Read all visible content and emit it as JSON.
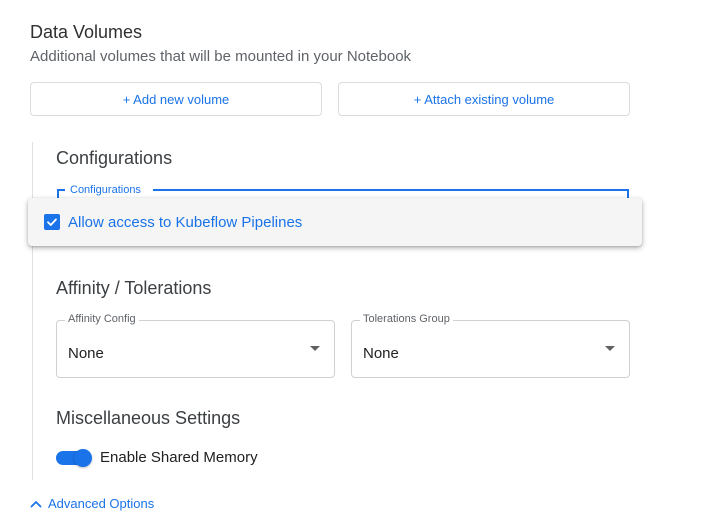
{
  "data_volumes": {
    "title": "Data Volumes",
    "subtitle": "Additional volumes that will be mounted in your Notebook",
    "add_button": "+ Add new volume",
    "attach_button": "+ Attach existing volume"
  },
  "configurations": {
    "title": "Configurations",
    "field_label": "Configurations",
    "option_label": "Allow access to Kubeflow Pipelines",
    "option_checked": true
  },
  "affinity": {
    "title": "Affinity / Tolerations",
    "affinity_label": "Affinity Config",
    "affinity_value": "None",
    "tolerations_label": "Tolerations Group",
    "tolerations_value": "None"
  },
  "misc": {
    "title": "Miscellaneous Settings",
    "shared_memory_label": "Enable Shared Memory",
    "shared_memory_enabled": true
  },
  "advanced": {
    "label": "Advanced Options",
    "icon": "chevron-up-icon"
  },
  "colors": {
    "accent": "#1a73e8",
    "text": "#212121",
    "muted": "#5f6368"
  }
}
